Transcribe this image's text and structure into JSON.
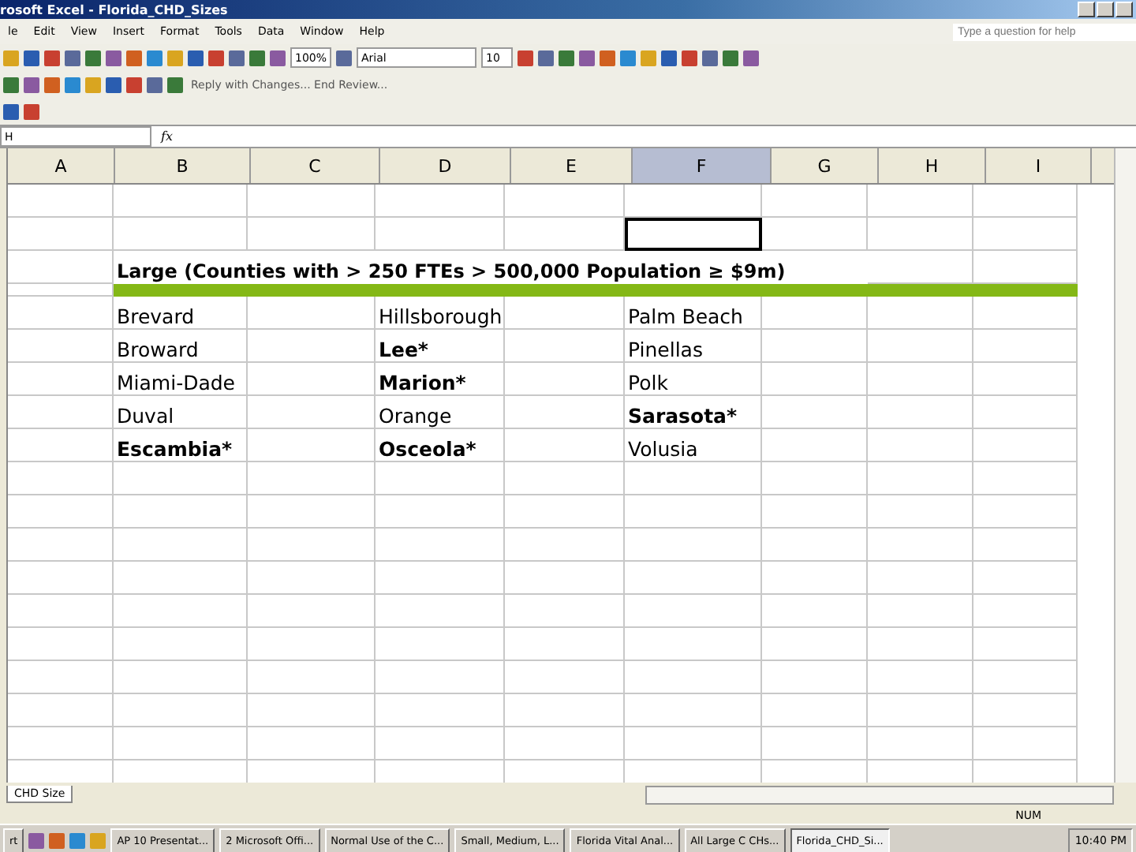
{
  "window": {
    "title": "rosoft Excel - Florida_CHD_Sizes"
  },
  "menu": [
    "le",
    "Edit",
    "View",
    "Insert",
    "Format",
    "Tools",
    "Data",
    "Window",
    "Help"
  ],
  "help_box": {
    "placeholder": "Type a question for help"
  },
  "toolbar": {
    "zoom": "100%",
    "font": "Arial",
    "font_size": "10",
    "review": "Reply with Changes... End Review..."
  },
  "name_box": {
    "value": "H"
  },
  "formula_bar": {
    "function_label": "fx"
  },
  "columns": [
    {
      "label": "A",
      "selected": false
    },
    {
      "label": "B",
      "selected": false
    },
    {
      "label": "C",
      "selected": false
    },
    {
      "label": "D",
      "selected": false
    },
    {
      "label": "E",
      "selected": false
    },
    {
      "label": "F",
      "selected": true
    },
    {
      "label": "G",
      "selected": false
    },
    {
      "label": "H",
      "selected": false
    },
    {
      "label": "I",
      "selected": false
    }
  ],
  "sheet": {
    "title": "Large (Counties with > 250 FTEs > 500,000 Population ≥ $9m)",
    "rows": [
      [
        {
          "text": "Brevard",
          "bold": false
        },
        {
          "text": "Hillsborough",
          "bold": false
        },
        {
          "text": "Palm Beach",
          "bold": false
        }
      ],
      [
        {
          "text": "Broward",
          "bold": false
        },
        {
          "text": "Lee*",
          "bold": true
        },
        {
          "text": "Pinellas",
          "bold": false
        }
      ],
      [
        {
          "text": "Miami-Dade",
          "bold": false
        },
        {
          "text": "Marion*",
          "bold": true
        },
        {
          "text": "Polk",
          "bold": false
        }
      ],
      [
        {
          "text": "Duval",
          "bold": false
        },
        {
          "text": "Orange",
          "bold": false
        },
        {
          "text": "Sarasota*",
          "bold": true
        }
      ],
      [
        {
          "text": "Escambia*",
          "bold": true
        },
        {
          "text": "Osceola*",
          "bold": true
        },
        {
          "text": "Volusia",
          "bold": false
        }
      ]
    ]
  },
  "sheet_tabs": [
    {
      "label": "CHD Size",
      "selected": true
    }
  ],
  "status_bar": {
    "mode": "NUM"
  },
  "taskbar": {
    "start": "rt",
    "tasks": [
      {
        "label": "AP 10 Presentat...",
        "selected": false
      },
      {
        "label": "2 Microsoft Offi...",
        "selected": false
      },
      {
        "label": "Normal Use of the C...",
        "selected": false
      },
      {
        "label": "Small, Medium, L...",
        "selected": false
      },
      {
        "label": "Florida Vital Anal...",
        "selected": false
      },
      {
        "label": "All Large C CHs...",
        "selected": false
      },
      {
        "label": "Florida_CHD_Si...",
        "selected": true
      }
    ],
    "clock": "10:40 PM"
  }
}
